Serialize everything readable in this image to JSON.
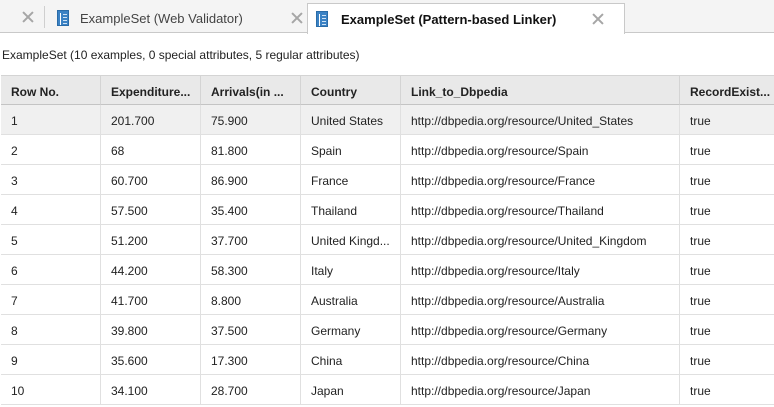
{
  "tabs": [
    {
      "label": "ExampleSet (Web Validator)",
      "active": false
    },
    {
      "label": "ExampleSet (Pattern-based Linker)",
      "active": true
    }
  ],
  "summary": "ExampleSet (10 examples, 0 special attributes, 5 regular attributes)",
  "table": {
    "columns": [
      "Row No.",
      "Expenditure...",
      "Arrivals(in ...",
      "Country",
      "Link_to_Dbpedia",
      "RecordExist..."
    ],
    "rows": [
      [
        "1",
        "201.700",
        "75.900",
        "United States",
        "http://dbpedia.org/resource/United_States",
        "true"
      ],
      [
        "2",
        "68",
        "81.800",
        "Spain",
        "http://dbpedia.org/resource/Spain",
        "true"
      ],
      [
        "3",
        "60.700",
        "86.900",
        "France",
        "http://dbpedia.org/resource/France",
        "true"
      ],
      [
        "4",
        "57.500",
        "35.400",
        "Thailand",
        "http://dbpedia.org/resource/Thailand",
        "true"
      ],
      [
        "5",
        "51.200",
        "37.700",
        "United Kingd...",
        "http://dbpedia.org/resource/United_Kingdom",
        "true"
      ],
      [
        "6",
        "44.200",
        "58.300",
        "Italy",
        "http://dbpedia.org/resource/Italy",
        "true"
      ],
      [
        "7",
        "41.700",
        "8.800",
        "Australia",
        "http://dbpedia.org/resource/Australia",
        "true"
      ],
      [
        "8",
        "39.800",
        "37.500",
        "Germany",
        "http://dbpedia.org/resource/Germany",
        "true"
      ],
      [
        "9",
        "35.600",
        "17.300",
        "China",
        "http://dbpedia.org/resource/China",
        "true"
      ],
      [
        "10",
        "34.100",
        "28.700",
        "Japan",
        "http://dbpedia.org/resource/Japan",
        "true"
      ]
    ]
  }
}
